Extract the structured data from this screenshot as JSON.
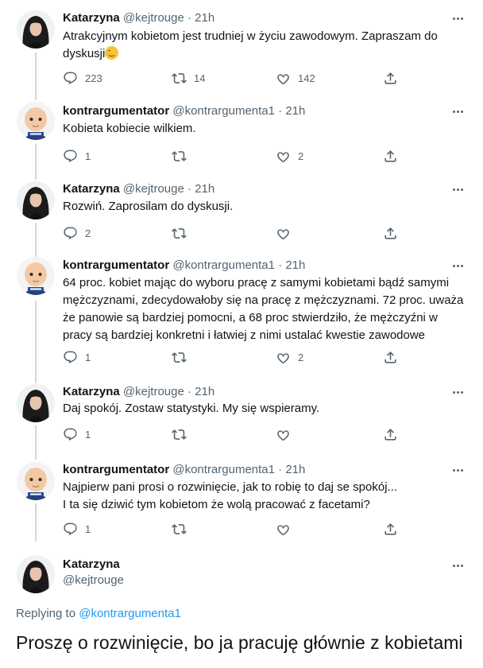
{
  "accent_color": "#1d9bf0",
  "tweets": [
    {
      "avatar": "woman-dark-hair-avatar",
      "name": "Katarzyna",
      "handle": "@kejtrouge",
      "dot": "·",
      "time": "21h",
      "text": "Atrakcyjnym kobietom jest trudniej w życiu zawodowym. Zapraszam do dyskusji",
      "emoji": "smiling-face-emoji",
      "replies": "223",
      "retweets": "14",
      "likes": "142"
    },
    {
      "avatar": "boss-baby-avatar",
      "name": "kontrargumentator",
      "handle": "@kontrargumenta1",
      "dot": "·",
      "time": "21h",
      "text": "Kobieta kobiecie wilkiem.",
      "replies": "1",
      "retweets": "",
      "likes": "2"
    },
    {
      "avatar": "woman-dark-hair-avatar",
      "name": "Katarzyna",
      "handle": "@kejtrouge",
      "dot": "·",
      "time": "21h",
      "text": "Rozwiń. Zaprosilam do dyskusji.",
      "replies": "2",
      "retweets": "",
      "likes": ""
    },
    {
      "avatar": "boss-baby-avatar",
      "name": "kontrargumentator",
      "handle": "@kontrargumenta1",
      "dot": "·",
      "time": "21h",
      "text_lines": [
        "64 proc. kobiet mając do wyboru pracę z samymi kobietami bądź samymi",
        "mężczyznami, zdecydowałoby się na pracę z mężczyznami. 72 proc. uważa",
        "że panowie są bardziej pomocni, a 68 proc stwierdziło, że mężczyźni w",
        "pracy są bardziej konkretni i łatwiej z nimi ustalać kwestie zawodowe"
      ],
      "replies": "1",
      "retweets": "",
      "likes": "2"
    },
    {
      "avatar": "woman-dark-hair-avatar",
      "name": "Katarzyna",
      "handle": "@kejtrouge",
      "dot": "·",
      "time": "21h",
      "text": "Daj spokój. Zostaw statystyki. My się wspieramy.",
      "replies": "1",
      "retweets": "",
      "likes": ""
    },
    {
      "avatar": "boss-baby-avatar",
      "name": "kontrargumentator",
      "handle": "@kontrargumenta1",
      "dot": "·",
      "time": "21h",
      "text_lines": [
        "Najpierw pani prosi o rozwinięcie, jak to robię to daj se spokój...",
        "I ta się dziwić tym kobietom że wolą pracować z facetami?"
      ],
      "replies": "1",
      "retweets": "",
      "likes": ""
    }
  ],
  "main_tweet": {
    "avatar": "woman-dark-hair-avatar",
    "name": "Katarzyna",
    "handle": "@kejtrouge",
    "replying_prefix": "Replying to ",
    "replying_to": "@kontrargumenta1",
    "text": "Proszę o rozwinięcie, bo ja pracuję głównie z kobietami"
  }
}
